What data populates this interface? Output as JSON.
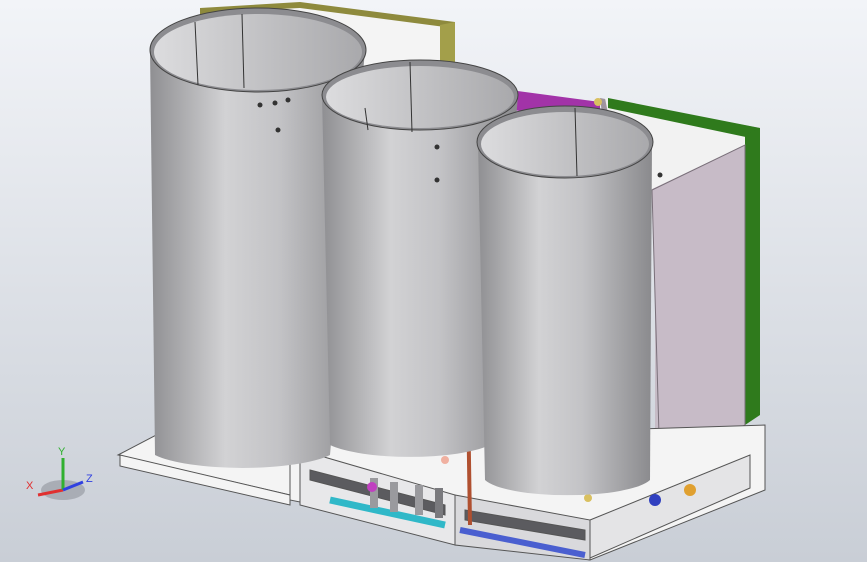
{
  "scene": {
    "type": "3d-cad-model",
    "background_top": "#f2f4f8",
    "background_bottom": "#c9ced6"
  },
  "model": {
    "tank_color": "#b8b8bb",
    "frame_color": "#f2f2f2",
    "back_panel_left": "#8e8a3d",
    "back_panel_middle": "#a233a8",
    "back_panel_right": "#2f7a1c",
    "cabinet_color": "#c4b8c4",
    "pipe_blue": "#4a5fd0",
    "pipe_cyan": "#30b8c8",
    "pipe_copper": "#b05030"
  },
  "triad": {
    "x_label": "X",
    "y_label": "Y",
    "z_label": "Z",
    "x_color": "#e03030",
    "y_color": "#30b030",
    "z_color": "#3040e0"
  }
}
